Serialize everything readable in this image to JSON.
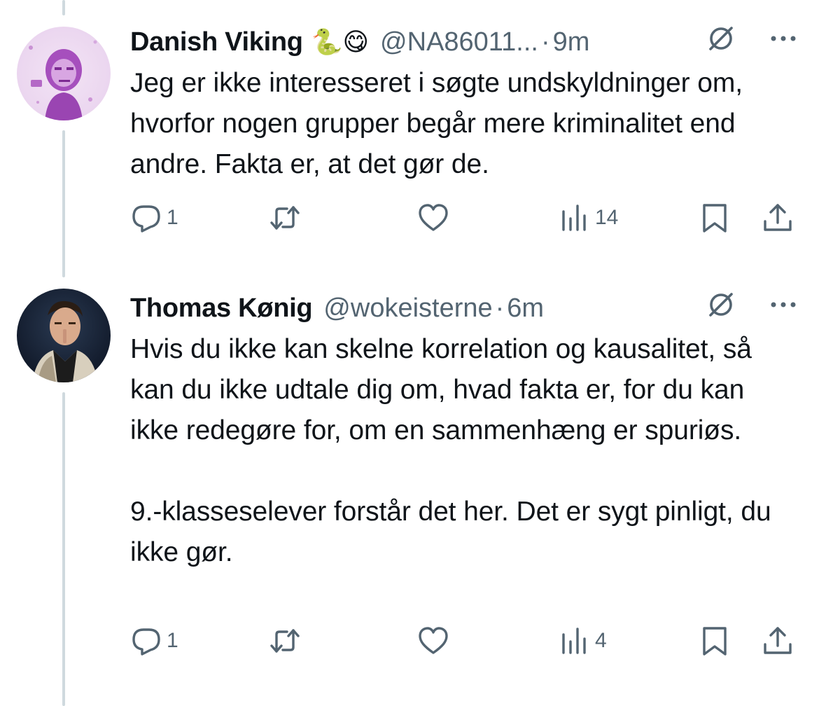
{
  "tweets": [
    {
      "name": "Danish Viking",
      "emojis": "🐍😋",
      "handle": "@NA86011...",
      "dot": "·",
      "time": "9m",
      "text_paragraphs": [
        "Jeg er ikke interesseret i søgte undskyldninger om, hvorfor nogen grupper begår mere kriminalitet end andre. Fakta er, at det gør de."
      ],
      "reply_count": "1",
      "retweet_count": "",
      "like_count": "",
      "views_count": "14"
    },
    {
      "name": "Thomas Kønig",
      "handle": "@wokeisterne",
      "dot": "·",
      "time": "6m",
      "text_paragraphs": [
        "Hvis du ikke kan skelne korrelation og kausalitet, så kan du ikke udtale dig om, hvad fakta er, for du kan ikke redegøre for, om en sammenhæng er spuriøs.",
        "9.-klasseselever forstår det her. Det er sygt pinligt, du ikke gør."
      ],
      "reply_count": "1",
      "retweet_count": "",
      "like_count": "",
      "views_count": "4"
    }
  ],
  "icons": {
    "reply": "reply-icon",
    "retweet": "retweet-icon",
    "like": "heart-icon",
    "views": "views-icon",
    "bookmark": "bookmark-icon",
    "share": "share-icon",
    "grok": "grok-icon",
    "more": "more-icon"
  },
  "colors": {
    "text": "#0f1419",
    "secondary": "#536471",
    "thread_line": "#cfd9de"
  }
}
